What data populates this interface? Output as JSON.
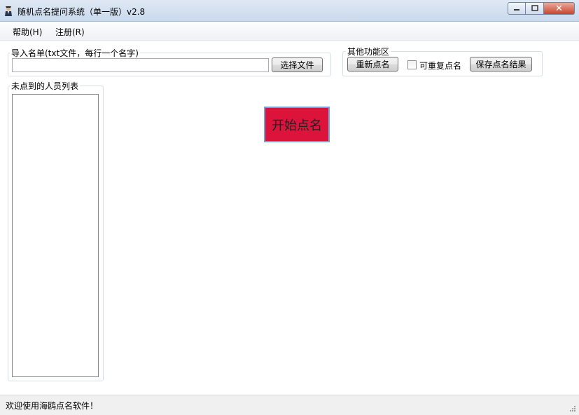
{
  "window": {
    "title": "随机点名提问系统（单一版）v2.8",
    "buttons": {
      "minimize": "–",
      "maximize": "□",
      "close": "✕"
    }
  },
  "menu": [
    {
      "label": "帮助(H)"
    },
    {
      "label": "注册(R)"
    }
  ],
  "import_group": {
    "label": "导入名单(txt文件，每行一个名字)",
    "file_path_value": "",
    "choose_file_button": "选择文件"
  },
  "other_group": {
    "label": "其他功能区",
    "reset_button": "重新点名",
    "repeat_checkbox_label": "可重复点名",
    "repeat_checked": false,
    "save_button": "保存点名结果"
  },
  "list_group": {
    "label": "未点到的人员列表",
    "items": []
  },
  "start_button": "开始点名",
  "status": "欢迎使用海鸥点名软件！",
  "colors": {
    "start_button_bg": "#dc143c",
    "start_button_border": "#6aa6d6"
  }
}
